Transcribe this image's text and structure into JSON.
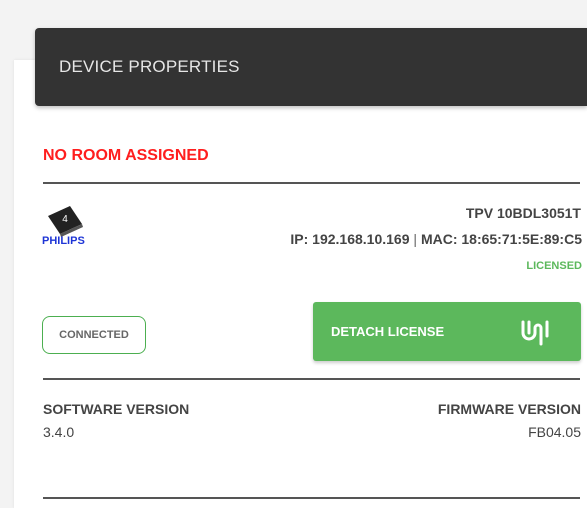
{
  "header": {
    "title": "DEVICE PROPERTIES"
  },
  "room_status": "NO ROOM ASSIGNED",
  "device": {
    "brand": "PHILIPS",
    "badge_count": "4",
    "model": "TPV 10BDL3051T",
    "ip_label": "IP: 192.168.10.169",
    "separator": "|",
    "mac_label": "MAC: 18:65:71:5E:89:C5",
    "license_status": "LICENSED",
    "connection_status": "CONNECTED"
  },
  "actions": {
    "detach_label": "DETACH LICENSE",
    "detach_icon": "magnet-icon"
  },
  "versions": {
    "software_label": "SOFTWARE VERSION",
    "software_value": "3.4.0",
    "firmware_label": "FIRMWARE VERSION",
    "firmware_value": "FB04.05"
  },
  "colors": {
    "header_bg": "#333333",
    "alert": "#ff1e1e",
    "success": "#5cb85c"
  }
}
